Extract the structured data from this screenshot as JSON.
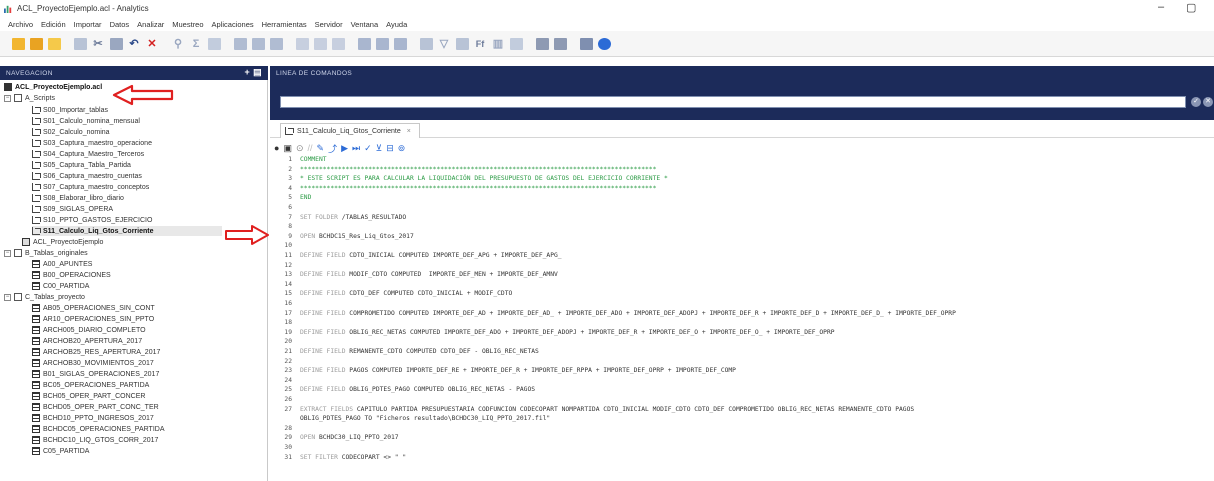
{
  "window": {
    "title": "ACL_ProyectoEjemplo.acl - Analytics",
    "min": "–",
    "max": "▢"
  },
  "menu": [
    "Archivo",
    "Edición",
    "Importar",
    "Datos",
    "Analizar",
    "Muestreo",
    "Aplicaciones",
    "Herramientas",
    "Servidor",
    "Ventana",
    "Ayuda"
  ],
  "panels": {
    "nav_title": "NAVEGACION",
    "nav_actions": "+ ▤",
    "cmd_title": "LINEA DE COMANDOS"
  },
  "tree": {
    "project": "ACL_ProyectoEjemplo.acl",
    "folders": {
      "scripts": "A_Scripts",
      "tablas_originales": "B_Tablas_originales",
      "tablas_proyecto": "C_Tablas_proyecto"
    },
    "scripts": [
      "S00_Importar_tablas",
      "S01_Calculo_nomina_mensual",
      "S02_Calculo_nomina",
      "S03_Captura_maestro_operacione",
      "S04_Captura_Maestro_Terceros",
      "S05_Captura_Tabla_Partida",
      "S06_Captura_maestro_cuentas",
      "S07_Captura_maestro_conceptos",
      "S08_Elaborar_libro_diario",
      "S09_SIGLAS_OPERA",
      "S10_PPTO_GASTOS_EJERCICIO",
      "S11_Calculo_Liq_Gtos_Corriente"
    ],
    "log": "ACL_ProyectoEjemplo",
    "tablas_originales": [
      "A00_APUNTES",
      "B00_OPERACIONES",
      "C00_PARTIDA"
    ],
    "tablas_proyecto": [
      "AB05_OPERACIONES_SIN_CONT",
      "AR10_OPERACIONES_SIN_PPTO",
      "ARCH005_DIARIO_COMPLETO",
      "ARCHOB20_APERTURA_2017",
      "ARCHOB25_RES_APERTURA_2017",
      "ARCHOB30_MOVIMIENTOS_2017",
      "B01_SIGLAS_OPERACIONES_2017",
      "BC05_OPERACIONES_PARTIDA",
      "BCH05_OPER_PART_CONCER",
      "BCHD05_OPER_PART_CONC_TER",
      "BCHD10_PPTO_INGRESOS_2017",
      "BCHDC05_OPERACIONES_PARTIDA",
      "BCHDC10_LIQ_GTOS_CORR_2017",
      "C05_PARTIDA"
    ]
  },
  "editor": {
    "tab_label": "S11_Calculo_Liq_Gtos_Corriente",
    "tab_close": "×",
    "lines": [
      {
        "n": "1",
        "kw": "",
        "cm": "COMMENT",
        "tx": ""
      },
      {
        "n": "2",
        "kw": "",
        "cm": "**********************************************************************************************",
        "tx": ""
      },
      {
        "n": "3",
        "kw": "",
        "cm": "* ESTE SCRIPT ES PARA CALCULAR LA LIQUIDACIÓN DEL PRESUPUESTO DE GASTOS DEL EJERCICIO CORRIENTE *",
        "tx": ""
      },
      {
        "n": "4",
        "kw": "",
        "cm": "**********************************************************************************************",
        "tx": ""
      },
      {
        "n": "5",
        "kw": "",
        "cm": "END",
        "tx": ""
      },
      {
        "n": "6",
        "kw": "",
        "cm": "",
        "tx": ""
      },
      {
        "n": "7",
        "kw": "SET FOLDER",
        "cm": "",
        "tx": " /TABLAS_RESULTADO"
      },
      {
        "n": "8",
        "kw": "",
        "cm": "",
        "tx": ""
      },
      {
        "n": "9",
        "kw": "OPEN",
        "cm": "",
        "tx": " BCHDC15_Res_Liq_Gtos_2017"
      },
      {
        "n": "10",
        "kw": "",
        "cm": "",
        "tx": ""
      },
      {
        "n": "11",
        "kw": "DEFINE FIELD",
        "cm": "",
        "tx": " CDTO_INICIAL COMPUTED IMPORTE_DEF_APG + IMPORTE_DEF_APG_"
      },
      {
        "n": "12",
        "kw": "",
        "cm": "",
        "tx": ""
      },
      {
        "n": "13",
        "kw": "DEFINE FIELD",
        "cm": "",
        "tx": " MODIF_CDTO COMPUTED  IMPORTE_DEF_MEN + IMPORTE_DEF_AMNV"
      },
      {
        "n": "14",
        "kw": "",
        "cm": "",
        "tx": ""
      },
      {
        "n": "15",
        "kw": "DEFINE FIELD",
        "cm": "",
        "tx": " CDTO_DEF COMPUTED CDTO_INICIAL + MODIF_CDTO"
      },
      {
        "n": "16",
        "kw": "",
        "cm": "",
        "tx": ""
      },
      {
        "n": "17",
        "kw": "DEFINE FIELD",
        "cm": "",
        "tx": " COMPROMETIDO COMPUTED IMPORTE_DEF_AD + IMPORTE_DEF_AD_ + IMPORTE_DEF_ADO + IMPORTE_DEF_ADOPJ + IMPORTE_DEF_R + IMPORTE_DEF_D + IMPORTE_DEF_D_ + IMPORTE_DEF_OPRP"
      },
      {
        "n": "18",
        "kw": "",
        "cm": "",
        "tx": ""
      },
      {
        "n": "19",
        "kw": "DEFINE FIELD",
        "cm": "",
        "tx": " OBLIG_REC_NETAS COMPUTED IMPORTE_DEF_ADO + IMPORTE_DEF_ADOPJ + IMPORTE_DEF_R + IMPORTE_DEF_O + IMPORTE_DEF_O_ + IMPORTE_DEF_OPRP"
      },
      {
        "n": "20",
        "kw": "",
        "cm": "",
        "tx": ""
      },
      {
        "n": "21",
        "kw": "DEFINE FIELD",
        "cm": "",
        "tx": " REMANENTE_CDTO COMPUTED CDTO_DEF - OBLIG_REC_NETAS"
      },
      {
        "n": "22",
        "kw": "",
        "cm": "",
        "tx": ""
      },
      {
        "n": "23",
        "kw": "DEFINE FIELD",
        "cm": "",
        "tx": " PAGOS COMPUTED IMPORTE_DEF_RE + IMPORTE_DEF_R + IMPORTE_DEF_RPPA + IMPORTE_DEF_OPRP + IMPORTE_DEF_COMP"
      },
      {
        "n": "24",
        "kw": "",
        "cm": "",
        "tx": ""
      },
      {
        "n": "25",
        "kw": "DEFINE FIELD",
        "cm": "",
        "tx": " OBLIG_PDTES_PAGO COMPUTED OBLIG_REC_NETAS - PAGOS"
      },
      {
        "n": "26",
        "kw": "",
        "cm": "",
        "tx": ""
      },
      {
        "n": "27",
        "kw": "EXTRACT FIELDS",
        "cm": "",
        "tx": " CAPITULO PARTIDA PRESUPUESTARIA CODFUNCION CODECOPART NOMPARTIDA CDTO_INICIAL MODIF_CDTO CDTO_DEF COMPROMETIDO OBLIG_REC_NETAS REMANENTE_CDTO PAGOS"
      },
      {
        "n": "",
        "kw": "",
        "cm": "",
        "tx": "OBLIG_PDTES_PAGO TO \"Ficheros resultado\\BCHDC30_LIQ_PPTO_2017.fil\""
      },
      {
        "n": "28",
        "kw": "",
        "cm": "",
        "tx": ""
      },
      {
        "n": "29",
        "kw": "OPEN",
        "cm": "",
        "tx": " BCHDC30_LIQ_PPTO_2017"
      },
      {
        "n": "30",
        "kw": "",
        "cm": "",
        "tx": ""
      },
      {
        "n": "31",
        "kw": "SET FILTER",
        "cm": "",
        "tx": " CODECOPART <> \" \""
      }
    ]
  },
  "colors": {
    "panel_header": "#1c2b5a",
    "arrow_red": "#e02020",
    "comment_green": "#2b9b45",
    "keyword_gray": "#9a9a9a"
  }
}
